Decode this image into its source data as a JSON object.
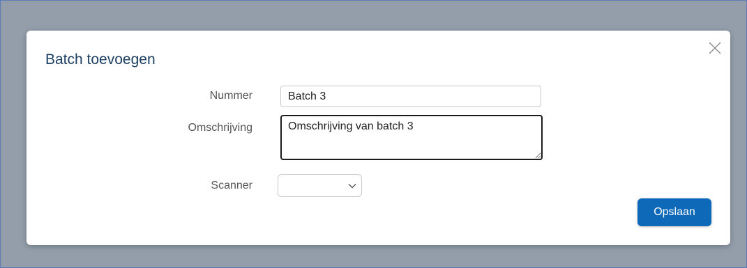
{
  "dialog": {
    "title": "Batch toevoegen",
    "close_icon": "close-icon"
  },
  "form": {
    "nummer": {
      "label": "Nummer",
      "value": "Batch 3"
    },
    "omschrijving": {
      "label": "Omschrijving",
      "value": "Omschrijving van batch 3"
    },
    "scanner": {
      "label": "Scanner",
      "selected": "",
      "icon": "chevron-down-icon"
    }
  },
  "actions": {
    "save_label": "Opslaan"
  },
  "colors": {
    "backdrop": "#939eaa",
    "title": "#1c3f63",
    "primary": "#0e6ab8"
  }
}
